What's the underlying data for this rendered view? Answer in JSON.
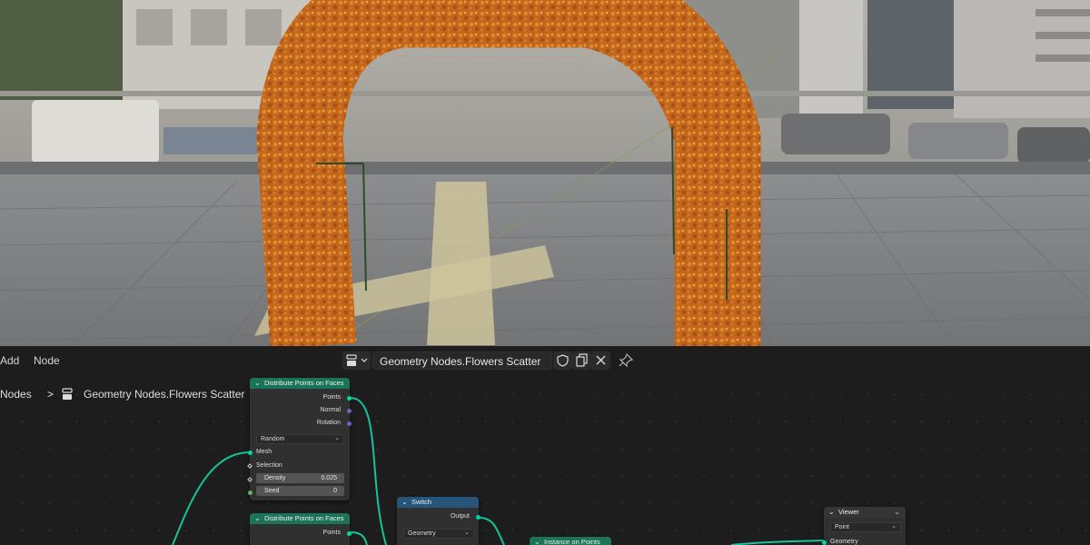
{
  "header": {
    "menu_add": "Add",
    "menu_node": "Node",
    "tree_name": "Geometry Nodes.Flowers Scatter",
    "icons": [
      "node-tree-icon",
      "chevron-down-icon",
      "fake-user-shield-icon",
      "duplicate-icon",
      "close-icon",
      "pin-icon"
    ]
  },
  "breadcrumb": {
    "root": "Nodes",
    "separator": ">",
    "current": "Geometry Nodes.Flowers Scatter"
  },
  "nodes": {
    "distribute1": {
      "title": "Distribute Points on Faces",
      "out_points": "Points",
      "out_normal": "Normal",
      "out_rotation": "Rotation",
      "mode": "Random",
      "in_mesh": "Mesh",
      "in_selection": "Selection",
      "density_label": "Density",
      "density_value": "0.025",
      "seed_label": "Seed",
      "seed_value": "0"
    },
    "distribute2": {
      "title": "Distribute Points on Faces",
      "out_points": "Points"
    },
    "switch": {
      "title": "Switch",
      "out_output": "Output",
      "type": "Geometry"
    },
    "instance": {
      "title": "Instance on Points"
    },
    "viewer": {
      "title": "Viewer",
      "domain": "Point",
      "in_geometry": "Geometry"
    }
  },
  "colors": {
    "geometry_socket": "#00d6a3",
    "node_header_geometry": "#1c7458",
    "node_header_utility": "#27557a",
    "editor_background": "#1d1d1d"
  }
}
